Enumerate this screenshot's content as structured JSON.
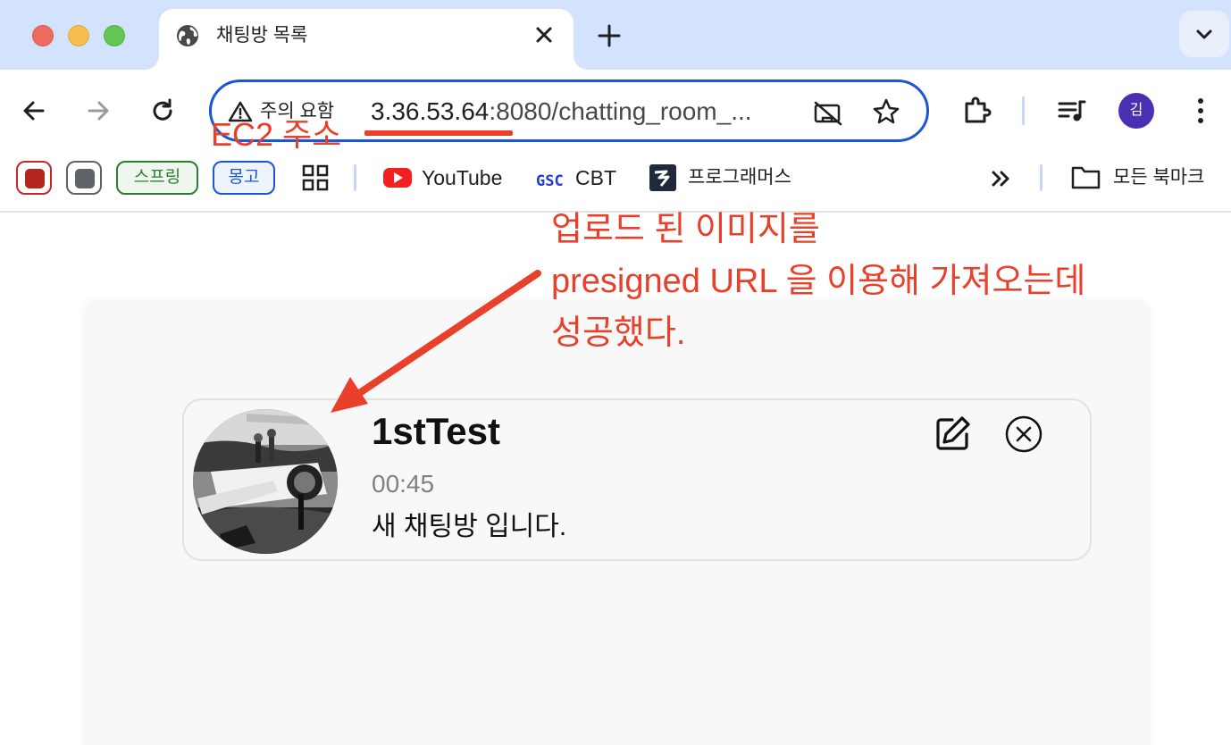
{
  "window": {
    "tab": {
      "title": "채팅방 목록",
      "favicon": "globe-icon",
      "close_icon": "close-icon"
    },
    "new_tab_icon": "plus-icon",
    "tab_search_icon": "chevron-down-icon"
  },
  "toolbar": {
    "security_warning": "주의 요함",
    "url_host": "3.36.53.64",
    "url_rest": ":8080/chatting_room_...",
    "profile_initial": "김"
  },
  "bookmarks": {
    "chips": [
      {
        "label": "스프링",
        "color": "#2e7d32"
      },
      {
        "label": "몽고",
        "color": "#1a57d4"
      }
    ],
    "items": [
      {
        "label": "YouTube",
        "icon": "youtube-icon"
      },
      {
        "label": "CBT",
        "icon": "gsc-icon",
        "icon_text": "GSC"
      },
      {
        "label": "프로그래머스",
        "icon": "programmers-icon"
      }
    ],
    "folder_label": "모든 북마크"
  },
  "room": {
    "name": "1stTest",
    "time": "00:45",
    "description": "새 채팅방 입니다."
  },
  "annotations": {
    "ec2_label": "EC2 주소",
    "note_lines": [
      "업로드 된 이미지를",
      "presigned URL 을 이용해 가져오는데",
      "성공했다."
    ],
    "color": "#e8402a"
  }
}
